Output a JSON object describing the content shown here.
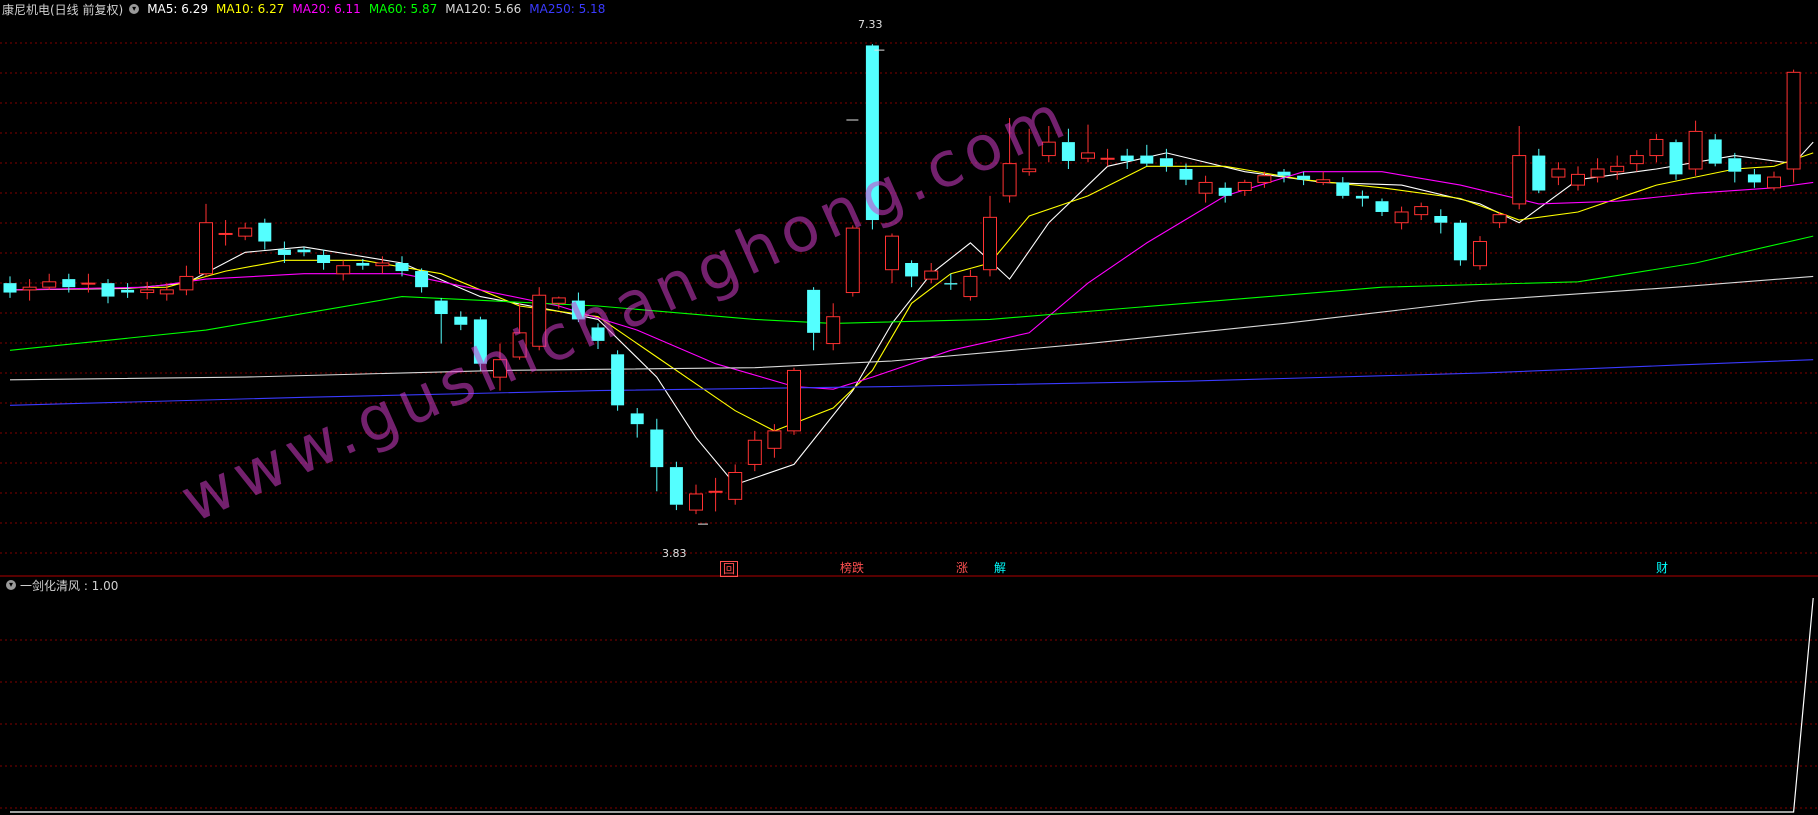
{
  "header": {
    "stock_name": "康尼机电(日线 前复权)",
    "ma_legend": [
      {
        "label": "MA5: 6.29",
        "color": "#ffffff"
      },
      {
        "label": "MA10: 6.27",
        "color": "#ffff00"
      },
      {
        "label": "MA20: 6.11",
        "color": "#ff00ff"
      },
      {
        "label": "MA60: 5.87",
        "color": "#00ff00"
      },
      {
        "label": "MA120: 5.66",
        "color": "#d8d8d8"
      },
      {
        "label": "MA250: 5.18",
        "color": "#3a3aff"
      }
    ]
  },
  "indicator": {
    "label": "一剑化清风 : 1.00"
  },
  "annotations": {
    "high": "7.33",
    "low": "3.83"
  },
  "signals": [
    {
      "text": "回",
      "color": "#ff5050"
    },
    {
      "text": "榜跌",
      "color": "#ff5050"
    },
    {
      "text": "涨",
      "color": "#ff5050"
    },
    {
      "text": "解",
      "color": "#00ffff"
    },
    {
      "text": "财",
      "color": "#00ffff"
    }
  ],
  "watermark": "www.gushichanghong.com",
  "colors": {
    "up": "#ff3232",
    "down": "#54ffff",
    "grid": "#800000",
    "divider": "#b00000"
  },
  "chart_data": {
    "type": "candlestick",
    "price_range": [
      3.6,
      7.45
    ],
    "candles": [
      [
        5.55,
        5.48,
        5.6,
        5.44
      ],
      [
        5.5,
        5.52,
        5.58,
        5.42
      ],
      [
        5.52,
        5.56,
        5.62,
        5.5
      ],
      [
        5.58,
        5.52,
        5.62,
        5.48
      ],
      [
        5.55,
        5.55,
        5.62,
        5.48
      ],
      [
        5.55,
        5.45,
        5.58,
        5.4
      ],
      [
        5.5,
        5.48,
        5.55,
        5.44
      ],
      [
        5.48,
        5.5,
        5.56,
        5.43
      ],
      [
        5.47,
        5.5,
        5.55,
        5.42
      ],
      [
        5.5,
        5.6,
        5.68,
        5.46
      ],
      [
        5.62,
        6.0,
        6.14,
        5.6
      ],
      [
        5.92,
        5.92,
        6.02,
        5.83
      ],
      [
        5.9,
        5.96,
        6.0,
        5.87
      ],
      [
        6.0,
        5.86,
        6.03,
        5.8
      ],
      [
        5.8,
        5.76,
        5.86,
        5.7
      ],
      [
        5.8,
        5.78,
        5.82,
        5.75
      ],
      [
        5.76,
        5.7,
        5.8,
        5.65
      ],
      [
        5.62,
        5.68,
        5.72,
        5.57
      ],
      [
        5.7,
        5.68,
        5.73,
        5.65
      ],
      [
        5.68,
        5.7,
        5.75,
        5.62
      ],
      [
        5.7,
        5.64,
        5.75,
        5.6
      ],
      [
        5.64,
        5.52,
        5.66,
        5.48
      ],
      [
        5.42,
        5.32,
        5.44,
        5.1
      ],
      [
        5.3,
        5.24,
        5.34,
        5.2
      ],
      [
        5.28,
        4.95,
        5.3,
        4.9
      ],
      [
        4.85,
        4.98,
        5.1,
        4.75
      ],
      [
        5.0,
        5.18,
        5.4,
        4.98
      ],
      [
        5.08,
        5.46,
        5.52,
        5.05
      ],
      [
        5.4,
        5.44,
        5.45,
        5.36
      ],
      [
        5.42,
        5.28,
        5.48,
        5.26
      ],
      [
        5.22,
        5.12,
        5.25,
        5.06
      ],
      [
        5.02,
        4.64,
        5.05,
        4.6
      ],
      [
        4.58,
        4.5,
        4.62,
        4.4
      ],
      [
        4.46,
        4.18,
        4.54,
        4.0
      ],
      [
        4.18,
        3.9,
        4.22,
        3.86
      ],
      [
        3.86,
        3.98,
        4.05,
        3.83
      ],
      [
        4.0,
        4.0,
        4.1,
        3.85
      ],
      [
        3.94,
        4.14,
        4.2,
        3.9
      ],
      [
        4.2,
        4.38,
        4.45,
        4.15
      ],
      [
        4.32,
        4.45,
        4.5,
        4.25
      ],
      [
        4.45,
        4.9,
        4.92,
        4.42
      ],
      [
        5.5,
        5.18,
        5.52,
        5.05
      ],
      [
        5.1,
        5.3,
        5.4,
        5.05
      ],
      [
        5.48,
        5.96,
        5.98,
        5.45
      ],
      [
        7.32,
        6.02,
        7.33,
        5.95
      ],
      [
        5.65,
        5.9,
        5.92,
        5.55
      ],
      [
        5.7,
        5.6,
        5.72,
        5.52
      ],
      [
        5.58,
        5.64,
        5.7,
        5.55
      ],
      [
        5.55,
        5.54,
        5.62,
        5.5
      ],
      [
        5.45,
        5.6,
        5.65,
        5.42
      ],
      [
        5.65,
        6.04,
        6.2,
        5.6
      ],
      [
        6.2,
        6.44,
        6.78,
        6.15
      ],
      [
        6.38,
        6.4,
        6.7,
        6.35
      ],
      [
        6.5,
        6.6,
        6.72,
        6.45
      ],
      [
        6.6,
        6.46,
        6.7,
        6.4
      ],
      [
        6.48,
        6.52,
        6.73,
        6.45
      ],
      [
        6.48,
        6.48,
        6.55,
        6.42
      ],
      [
        6.5,
        6.46,
        6.55,
        6.4
      ],
      [
        6.5,
        6.44,
        6.58,
        6.42
      ],
      [
        6.48,
        6.42,
        6.55,
        6.38
      ],
      [
        6.4,
        6.32,
        6.44,
        6.28
      ],
      [
        6.22,
        6.3,
        6.35,
        6.15
      ],
      [
        6.26,
        6.2,
        6.3,
        6.15
      ],
      [
        6.24,
        6.3,
        6.32,
        6.2
      ],
      [
        6.3,
        6.35,
        6.38,
        6.26
      ],
      [
        6.38,
        6.35,
        6.4,
        6.3
      ],
      [
        6.35,
        6.32,
        6.38,
        6.28
      ],
      [
        6.3,
        6.32,
        6.38,
        6.28
      ],
      [
        6.3,
        6.2,
        6.34,
        6.18
      ],
      [
        6.2,
        6.18,
        6.24,
        6.12
      ],
      [
        6.16,
        6.08,
        6.18,
        6.05
      ],
      [
        6.0,
        6.08,
        6.12,
        5.95
      ],
      [
        6.06,
        6.12,
        6.15,
        6.02
      ],
      [
        6.05,
        6.0,
        6.1,
        5.92
      ],
      [
        6.0,
        5.72,
        6.02,
        5.68
      ],
      [
        5.68,
        5.86,
        5.9,
        5.65
      ],
      [
        6.0,
        6.06,
        6.08,
        5.96
      ],
      [
        6.14,
        6.5,
        6.72,
        6.1
      ],
      [
        6.5,
        6.24,
        6.55,
        6.22
      ],
      [
        6.34,
        6.4,
        6.45,
        6.28
      ],
      [
        6.28,
        6.36,
        6.42,
        6.24
      ],
      [
        6.34,
        6.4,
        6.48,
        6.3
      ],
      [
        6.38,
        6.42,
        6.5,
        6.32
      ],
      [
        6.44,
        6.5,
        6.54,
        6.38
      ],
      [
        6.5,
        6.62,
        6.66,
        6.45
      ],
      [
        6.6,
        6.36,
        6.62,
        6.32
      ],
      [
        6.4,
        6.68,
        6.76,
        6.35
      ],
      [
        6.62,
        6.44,
        6.66,
        6.42
      ],
      [
        6.48,
        6.38,
        6.52,
        6.3
      ],
      [
        6.36,
        6.3,
        6.4,
        6.26
      ],
      [
        6.26,
        6.34,
        6.38,
        6.24
      ],
      [
        6.4,
        7.12,
        7.14,
        6.3
      ]
    ],
    "ma_lines": [
      {
        "name": "MA5",
        "color": "#ffffff",
        "values": [
          [
            0,
            5.5
          ],
          [
            6,
            5.51
          ],
          [
            9,
            5.55
          ],
          [
            12,
            5.78
          ],
          [
            15,
            5.82
          ],
          [
            20,
            5.7
          ],
          [
            24,
            5.45
          ],
          [
            28,
            5.34
          ],
          [
            30,
            5.28
          ],
          [
            33,
            4.85
          ],
          [
            35,
            4.4
          ],
          [
            37,
            4.05
          ],
          [
            40,
            4.2
          ],
          [
            43,
            4.75
          ],
          [
            45,
            5.25
          ],
          [
            47,
            5.62
          ],
          [
            49,
            5.85
          ],
          [
            51,
            5.58
          ],
          [
            53,
            6.0
          ],
          [
            56,
            6.42
          ],
          [
            59,
            6.52
          ],
          [
            63,
            6.38
          ],
          [
            67,
            6.3
          ],
          [
            71,
            6.28
          ],
          [
            75,
            6.14
          ],
          [
            77,
            6.0
          ],
          [
            80,
            6.32
          ],
          [
            84,
            6.4
          ],
          [
            88,
            6.5
          ],
          [
            91,
            6.44
          ],
          [
            92,
            6.6
          ]
        ]
      },
      {
        "name": "MA10",
        "color": "#ffff00",
        "values": [
          [
            0,
            5.5
          ],
          [
            8,
            5.52
          ],
          [
            11,
            5.64
          ],
          [
            14,
            5.72
          ],
          [
            18,
            5.72
          ],
          [
            22,
            5.62
          ],
          [
            26,
            5.38
          ],
          [
            30,
            5.3
          ],
          [
            33,
            5.0
          ],
          [
            37,
            4.6
          ],
          [
            39,
            4.45
          ],
          [
            42,
            4.62
          ],
          [
            44,
            4.9
          ],
          [
            46,
            5.4
          ],
          [
            48,
            5.62
          ],
          [
            50,
            5.7
          ],
          [
            52,
            6.05
          ],
          [
            55,
            6.2
          ],
          [
            58,
            6.42
          ],
          [
            62,
            6.42
          ],
          [
            66,
            6.32
          ],
          [
            70,
            6.26
          ],
          [
            74,
            6.18
          ],
          [
            77,
            6.02
          ],
          [
            80,
            6.08
          ],
          [
            84,
            6.28
          ],
          [
            88,
            6.4
          ],
          [
            90,
            6.42
          ],
          [
            92,
            6.52
          ]
        ]
      },
      {
        "name": "MA20",
        "color": "#ff00ff",
        "values": [
          [
            0,
            5.5
          ],
          [
            7,
            5.52
          ],
          [
            10,
            5.58
          ],
          [
            15,
            5.62
          ],
          [
            20,
            5.62
          ],
          [
            24,
            5.5
          ],
          [
            28,
            5.38
          ],
          [
            32,
            5.2
          ],
          [
            36,
            4.95
          ],
          [
            40,
            4.78
          ],
          [
            42,
            4.76
          ],
          [
            44,
            4.85
          ],
          [
            48,
            5.05
          ],
          [
            52,
            5.18
          ],
          [
            55,
            5.55
          ],
          [
            58,
            5.85
          ],
          [
            62,
            6.2
          ],
          [
            66,
            6.38
          ],
          [
            70,
            6.38
          ],
          [
            74,
            6.28
          ],
          [
            78,
            6.14
          ],
          [
            82,
            6.16
          ],
          [
            86,
            6.22
          ],
          [
            90,
            6.26
          ],
          [
            92,
            6.3
          ]
        ]
      },
      {
        "name": "MA60",
        "color": "#00ff00",
        "values": [
          [
            0,
            5.05
          ],
          [
            10,
            5.2
          ],
          [
            20,
            5.45
          ],
          [
            30,
            5.38
          ],
          [
            38,
            5.28
          ],
          [
            42,
            5.25
          ],
          [
            50,
            5.28
          ],
          [
            60,
            5.4
          ],
          [
            70,
            5.52
          ],
          [
            80,
            5.56
          ],
          [
            86,
            5.7
          ],
          [
            92,
            5.9
          ]
        ]
      },
      {
        "name": "MA120",
        "color": "#d8d8d8",
        "values": [
          [
            0,
            4.83
          ],
          [
            12,
            4.85
          ],
          [
            25,
            4.9
          ],
          [
            38,
            4.92
          ],
          [
            45,
            4.97
          ],
          [
            55,
            5.1
          ],
          [
            65,
            5.25
          ],
          [
            75,
            5.42
          ],
          [
            85,
            5.52
          ],
          [
            92,
            5.6
          ]
        ]
      },
      {
        "name": "MA250",
        "color": "#3a3aff",
        "values": [
          [
            0,
            4.64
          ],
          [
            15,
            4.7
          ],
          [
            30,
            4.75
          ],
          [
            45,
            4.78
          ],
          [
            60,
            4.82
          ],
          [
            75,
            4.88
          ],
          [
            85,
            4.94
          ],
          [
            92,
            4.98
          ]
        ]
      }
    ],
    "indicator_line": {
      "range": [
        0,
        1
      ],
      "values": [
        [
          0,
          0
        ],
        [
          91,
          0
        ],
        [
          92,
          1
        ]
      ]
    }
  }
}
